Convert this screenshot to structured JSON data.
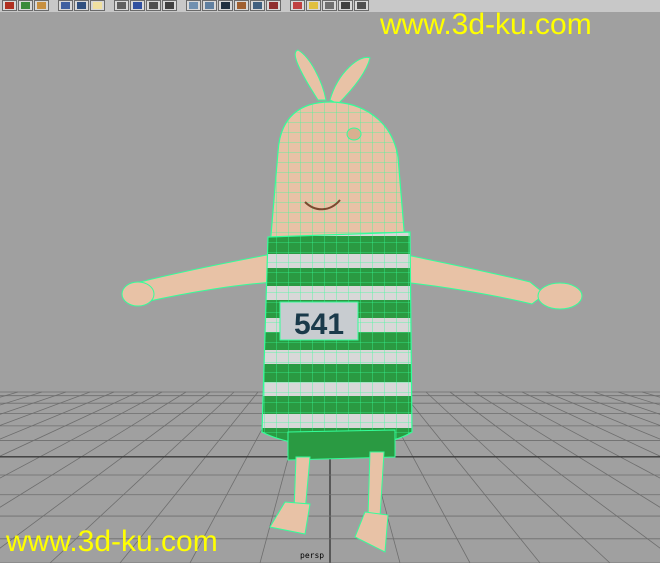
{
  "toolbar": {
    "icons": [
      {
        "name": "render-icon",
        "color": "#b03020"
      },
      {
        "name": "layers-icon",
        "color": "#3a8a3a"
      },
      {
        "name": "shelf-icon",
        "color": "#c89040"
      },
      {
        "name": "hypershade-icon",
        "color": "#4060a0"
      },
      {
        "name": "uv-editor-icon",
        "color": "#305080"
      },
      {
        "name": "light-icon",
        "color": "#f0e0a0"
      },
      {
        "name": "grid-icon",
        "color": "#606060"
      },
      {
        "name": "graph-editor-icon",
        "color": "#3050a0"
      },
      {
        "name": "outliner-icon",
        "color": "#505050"
      },
      {
        "name": "script-editor-icon",
        "color": "#404040"
      },
      {
        "name": "sphere-icon",
        "color": "#7090b0"
      },
      {
        "name": "cube-icon",
        "color": "#6080a0"
      },
      {
        "name": "camera-icon",
        "color": "#203040"
      },
      {
        "name": "texture-icon",
        "color": "#a06030"
      },
      {
        "name": "paint-icon",
        "color": "#406080"
      },
      {
        "name": "material-icon",
        "color": "#903030"
      },
      {
        "name": "blend-icon",
        "color": "#c04040"
      },
      {
        "name": "bulb-icon",
        "color": "#e0c040"
      },
      {
        "name": "key-icon",
        "color": "#707070"
      },
      {
        "name": "frame-icon",
        "color": "#404040"
      },
      {
        "name": "link-icon",
        "color": "#505050"
      }
    ]
  },
  "viewport": {
    "camera_label": "persp"
  },
  "watermarks": {
    "top": "www.3d-ku.com",
    "bottom": "www.3d-ku.com"
  },
  "colors": {
    "background": "#a0a0a0",
    "grid": "#6e6e6e",
    "grid_axis": "#3a3a3a",
    "wireframe": "#33ff99",
    "skin": "#e8c2a6",
    "shirt_green": "#2a9a42",
    "shirt_white": "#d8d8d8",
    "watermark": "#ffff00"
  },
  "character": {
    "shirt_number": "541"
  }
}
